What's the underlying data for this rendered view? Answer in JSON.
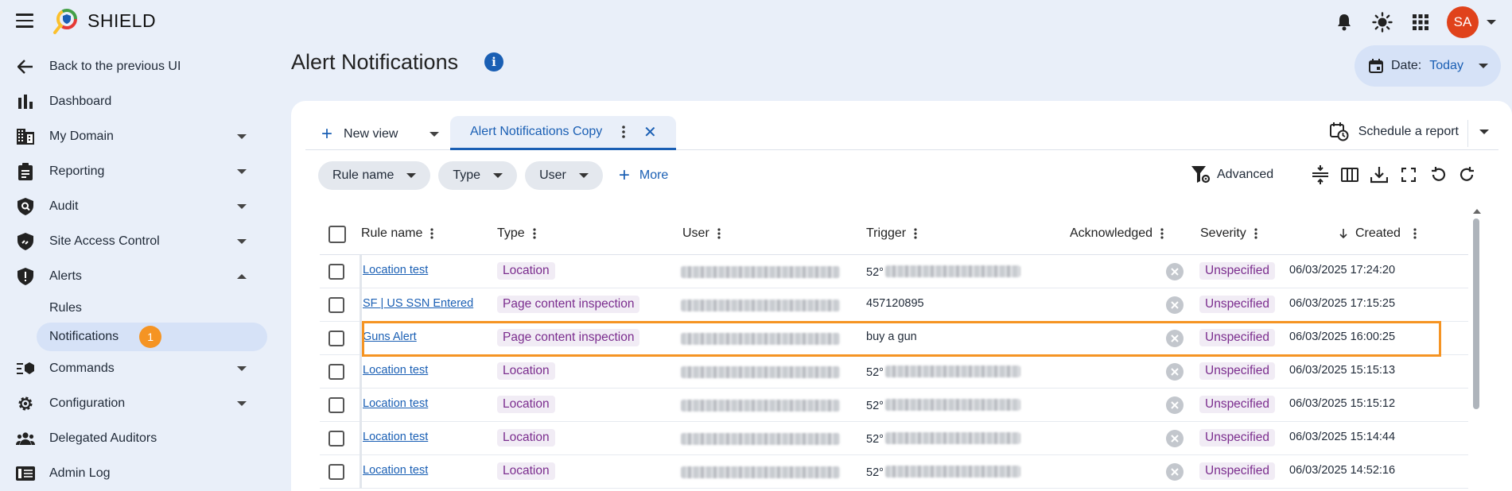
{
  "brand": "SHIELD",
  "user_initials": "SA",
  "sidebar": {
    "back": "Back to the previous UI",
    "items": [
      {
        "label": "Dashboard"
      },
      {
        "label": "My Domain"
      },
      {
        "label": "Reporting"
      },
      {
        "label": "Audit"
      },
      {
        "label": "Site Access Control"
      },
      {
        "label": "Alerts"
      },
      {
        "label": "Commands"
      },
      {
        "label": "Configuration"
      },
      {
        "label": "Delegated Auditors"
      },
      {
        "label": "Admin Log"
      }
    ],
    "alerts_sub": [
      {
        "label": "Rules"
      },
      {
        "label": "Notifications",
        "badge": "1"
      }
    ]
  },
  "page": {
    "title": "Alert Notifications",
    "date_label": "Date:",
    "date_value": "Today"
  },
  "tabs": {
    "new_view": "New view",
    "active_tab": "Alert Notifications Copy",
    "schedule": "Schedule a report"
  },
  "filters": {
    "chips": [
      "Rule name",
      "Type",
      "User"
    ],
    "more": "More",
    "advanced": "Advanced"
  },
  "table": {
    "columns": [
      "Rule name",
      "Type",
      "User",
      "Trigger",
      "Acknowledged",
      "Severity",
      "Created"
    ],
    "rows": [
      {
        "rule": "Location test",
        "type": "Location",
        "trigger": "52°",
        "severity": "Unspecified",
        "created": "06/03/2025 17:24:20"
      },
      {
        "rule": "SF | US SSN Entered",
        "type": "Page content inspection",
        "trigger": "457120895",
        "severity": "Unspecified",
        "created": "06/03/2025 17:15:25"
      },
      {
        "rule": "Guns Alert",
        "type": "Page content inspection",
        "trigger": "buy a gun",
        "severity": "Unspecified",
        "created": "06/03/2025 16:00:25"
      },
      {
        "rule": "Location test",
        "type": "Location",
        "trigger": "52°",
        "severity": "Unspecified",
        "created": "06/03/2025 15:15:13"
      },
      {
        "rule": "Location test",
        "type": "Location",
        "trigger": "52°",
        "severity": "Unspecified",
        "created": "06/03/2025 15:15:12"
      },
      {
        "rule": "Location test",
        "type": "Location",
        "trigger": "52°",
        "severity": "Unspecified",
        "created": "06/03/2025 15:14:44"
      },
      {
        "rule": "Location test",
        "type": "Location",
        "trigger": "52°",
        "severity": "Unspecified",
        "created": "06/03/2025 14:52:16"
      }
    ]
  },
  "colors": {
    "accent": "#1a5fb4",
    "highlight": "#f59423",
    "tag_text": "#7b2d8e",
    "background": "#e9eff9"
  }
}
